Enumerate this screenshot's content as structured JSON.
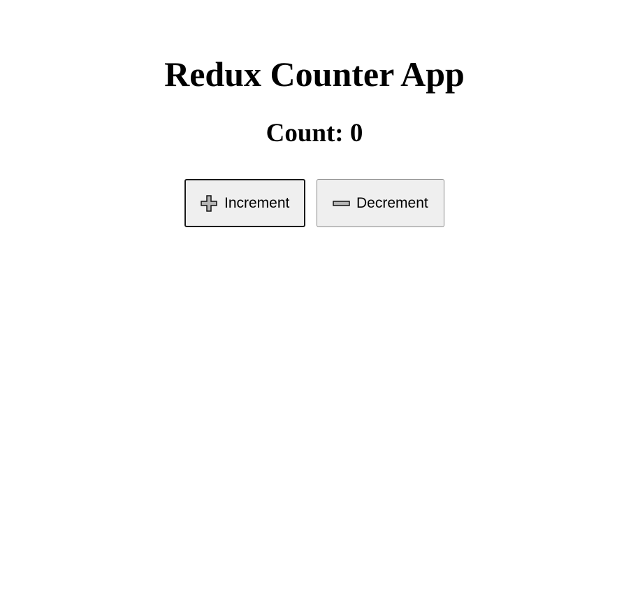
{
  "header": {
    "title": "Redux Counter App"
  },
  "counter": {
    "label": "Count:",
    "value": "0"
  },
  "controls": {
    "increment": {
      "label": "Increment",
      "icon": "plus-icon"
    },
    "decrement": {
      "label": "Decrement",
      "icon": "minus-icon"
    }
  },
  "colors": {
    "background": "#ffffff",
    "button_face": "#efefef",
    "icon_fill": "#b5b5b5",
    "focused_border": "#1a1a1a",
    "border": "#8a8a8a"
  }
}
